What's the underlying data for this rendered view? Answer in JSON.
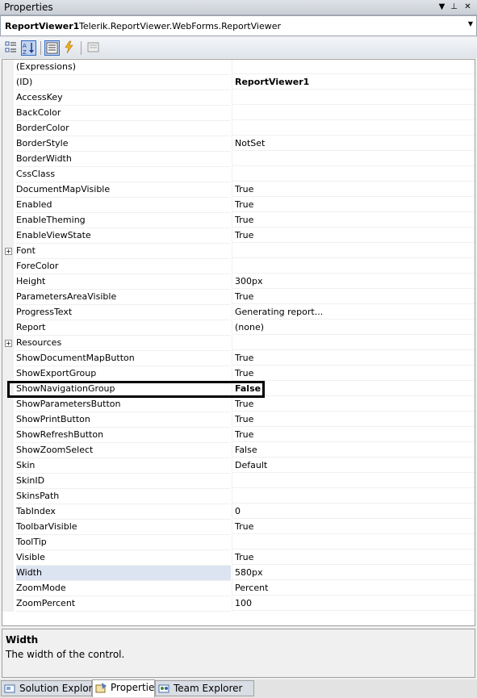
{
  "window": {
    "title": "Properties",
    "buttons": [
      "▼",
      "⊥",
      "✕"
    ]
  },
  "object_selector": {
    "name": "ReportViewer1",
    "type": "Telerik.ReportViewer.WebForms.ReportViewer"
  },
  "properties": [
    {
      "name": "(Expressions)",
      "value": ""
    },
    {
      "name": "(ID)",
      "value": "ReportViewer1"
    },
    {
      "name": "AccessKey",
      "value": ""
    },
    {
      "name": "BackColor",
      "value": ""
    },
    {
      "name": "BorderColor",
      "value": ""
    },
    {
      "name": "BorderStyle",
      "value": "NotSet"
    },
    {
      "name": "BorderWidth",
      "value": ""
    },
    {
      "name": "CssClass",
      "value": ""
    },
    {
      "name": "DocumentMapVisible",
      "value": "True"
    },
    {
      "name": "Enabled",
      "value": "True"
    },
    {
      "name": "EnableTheming",
      "value": "True"
    },
    {
      "name": "EnableViewState",
      "value": "True"
    },
    {
      "name": "Font",
      "value": ""
    },
    {
      "name": "ForeColor",
      "value": ""
    },
    {
      "name": "Height",
      "value": "300px"
    },
    {
      "name": "ParametersAreaVisible",
      "value": "True"
    },
    {
      "name": "ProgressText",
      "value": "Generating report..."
    },
    {
      "name": "Report",
      "value": "(none)"
    },
    {
      "name": "Resources",
      "value": ""
    },
    {
      "name": "ShowDocumentMapButton",
      "value": "True"
    },
    {
      "name": "ShowExportGroup",
      "value": "True"
    },
    {
      "name": "ShowNavigationGroup",
      "value": "False"
    },
    {
      "name": "ShowParametersButton",
      "value": "True"
    },
    {
      "name": "ShowPrintButton",
      "value": "True"
    },
    {
      "name": "ShowRefreshButton",
      "value": "True"
    },
    {
      "name": "ShowZoomSelect",
      "value": "False"
    },
    {
      "name": "Skin",
      "value": "Default"
    },
    {
      "name": "SkinID",
      "value": ""
    },
    {
      "name": "SkinsPath",
      "value": ""
    },
    {
      "name": "TabIndex",
      "value": "0"
    },
    {
      "name": "ToolbarVisible",
      "value": "True"
    },
    {
      "name": "ToolTip",
      "value": ""
    },
    {
      "name": "Visible",
      "value": "True"
    },
    {
      "name": "Width",
      "value": "580px"
    },
    {
      "name": "ZoomMode",
      "value": "Percent"
    },
    {
      "name": "ZoomPercent",
      "value": "100"
    }
  ],
  "description": {
    "title": "Width",
    "text": "The width of the control."
  },
  "tabs": [
    {
      "label": "Solution Explorer"
    },
    {
      "label": "Properties"
    },
    {
      "label": "Team Explorer"
    }
  ]
}
